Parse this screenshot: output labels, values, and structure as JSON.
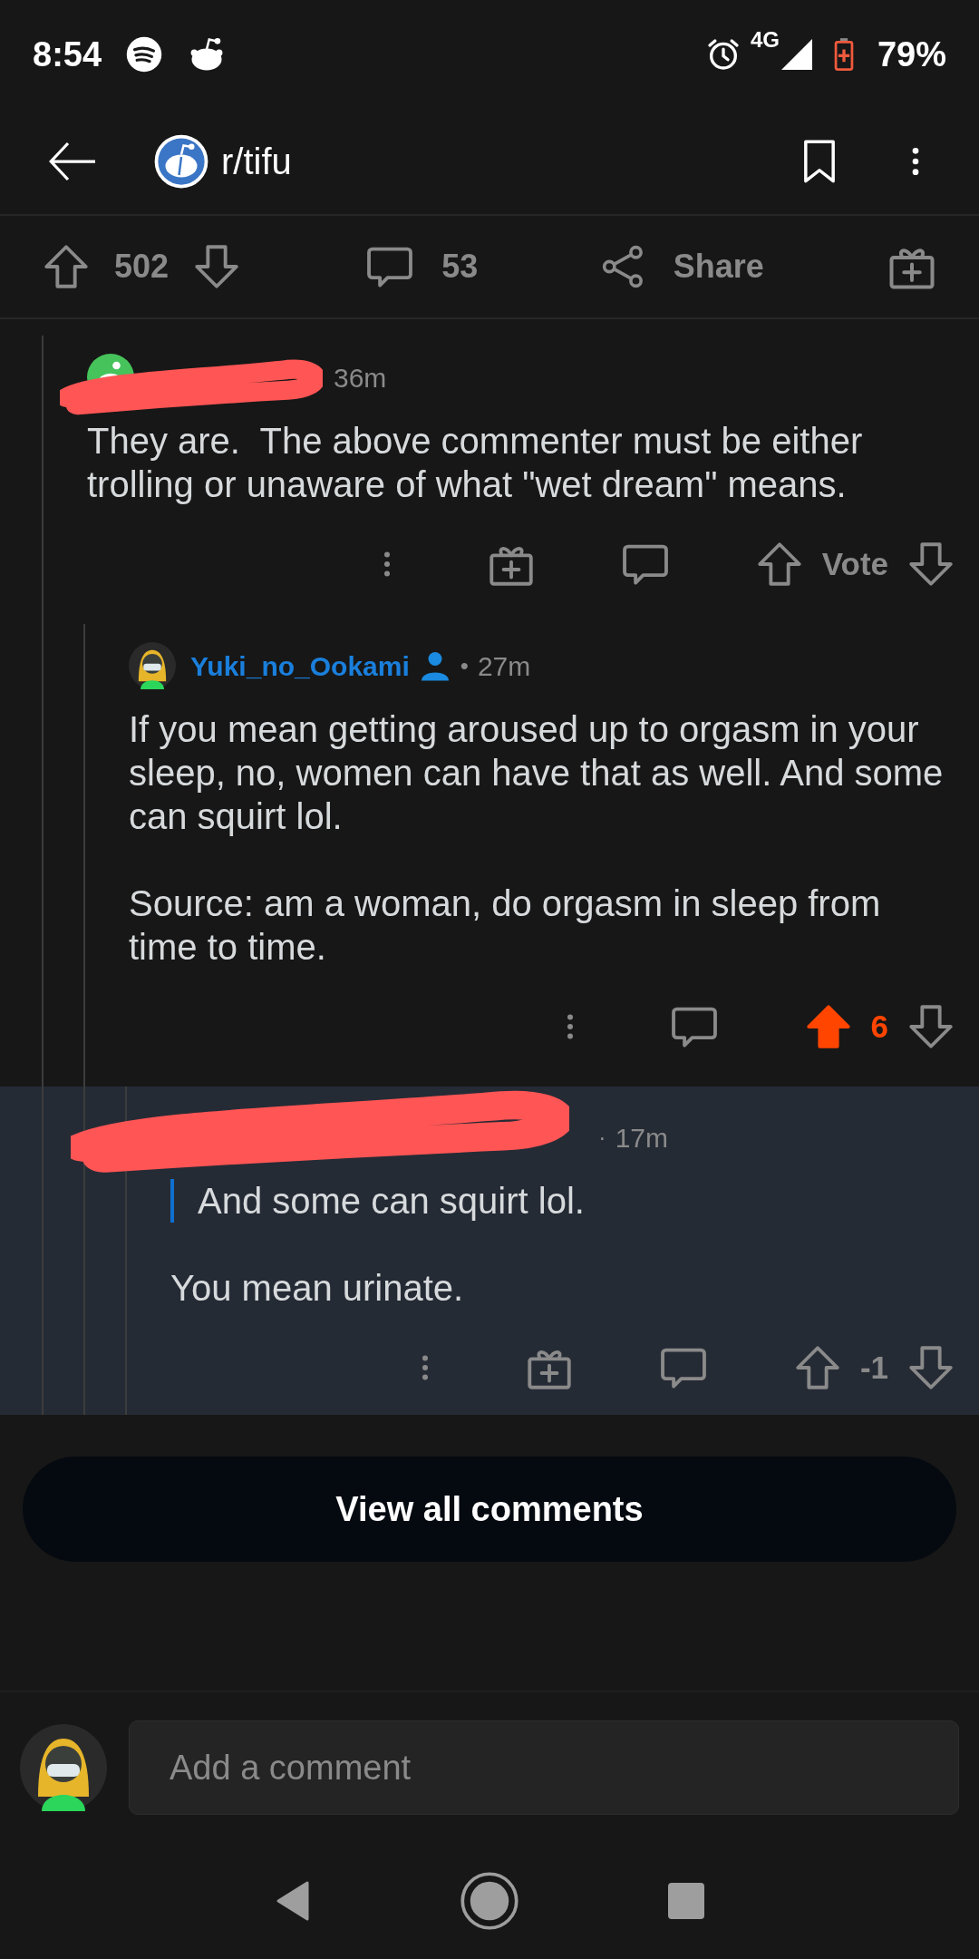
{
  "status_bar": {
    "time": "8:54",
    "network": "4G",
    "battery": "79%"
  },
  "header": {
    "subreddit": "r/tifu"
  },
  "post_bar": {
    "score": "502",
    "comment_count": "53",
    "share": "Share"
  },
  "comments": [
    {
      "has_avatar": true,
      "author_redacted": true,
      "time": "36m",
      "paragraphs": [
        {
          "kind": "text",
          "text": "They are.  The above commenter must be either trolling or unaware of what \"wet dream\" means."
        }
      ],
      "gift": true,
      "vote": {
        "score": "Vote",
        "upvoted": false
      },
      "highlighted": false,
      "children": [
        {
          "has_avatar": true,
          "author": "Yuki_no_Ookami",
          "author_redacted": false,
          "separator": "•",
          "time": "27m",
          "paragraphs": [
            {
              "kind": "text",
              "text": "If you mean getting aroused up to orgasm in your sleep, no, women can have that as well. And some can squirt lol."
            },
            {
              "kind": "text",
              "text": "Source: am a woman, do orgasm in sleep from time to time."
            }
          ],
          "gift": false,
          "vote": {
            "score": "6",
            "upvoted": true
          },
          "highlighted": false,
          "children": [
            {
              "has_avatar": false,
              "author_redacted": true,
              "separator": "·",
              "time": "17m",
              "paragraphs": [
                {
                  "kind": "quote",
                  "text": "And some can squirt lol."
                },
                {
                  "kind": "text",
                  "text": "You mean urinate."
                }
              ],
              "gift": true,
              "vote": {
                "score": "-1",
                "upvoted": false
              },
              "highlighted": true
            }
          ]
        }
      ]
    }
  ],
  "view_all": "View all comments",
  "composer": {
    "placeholder": "Add a comment"
  }
}
